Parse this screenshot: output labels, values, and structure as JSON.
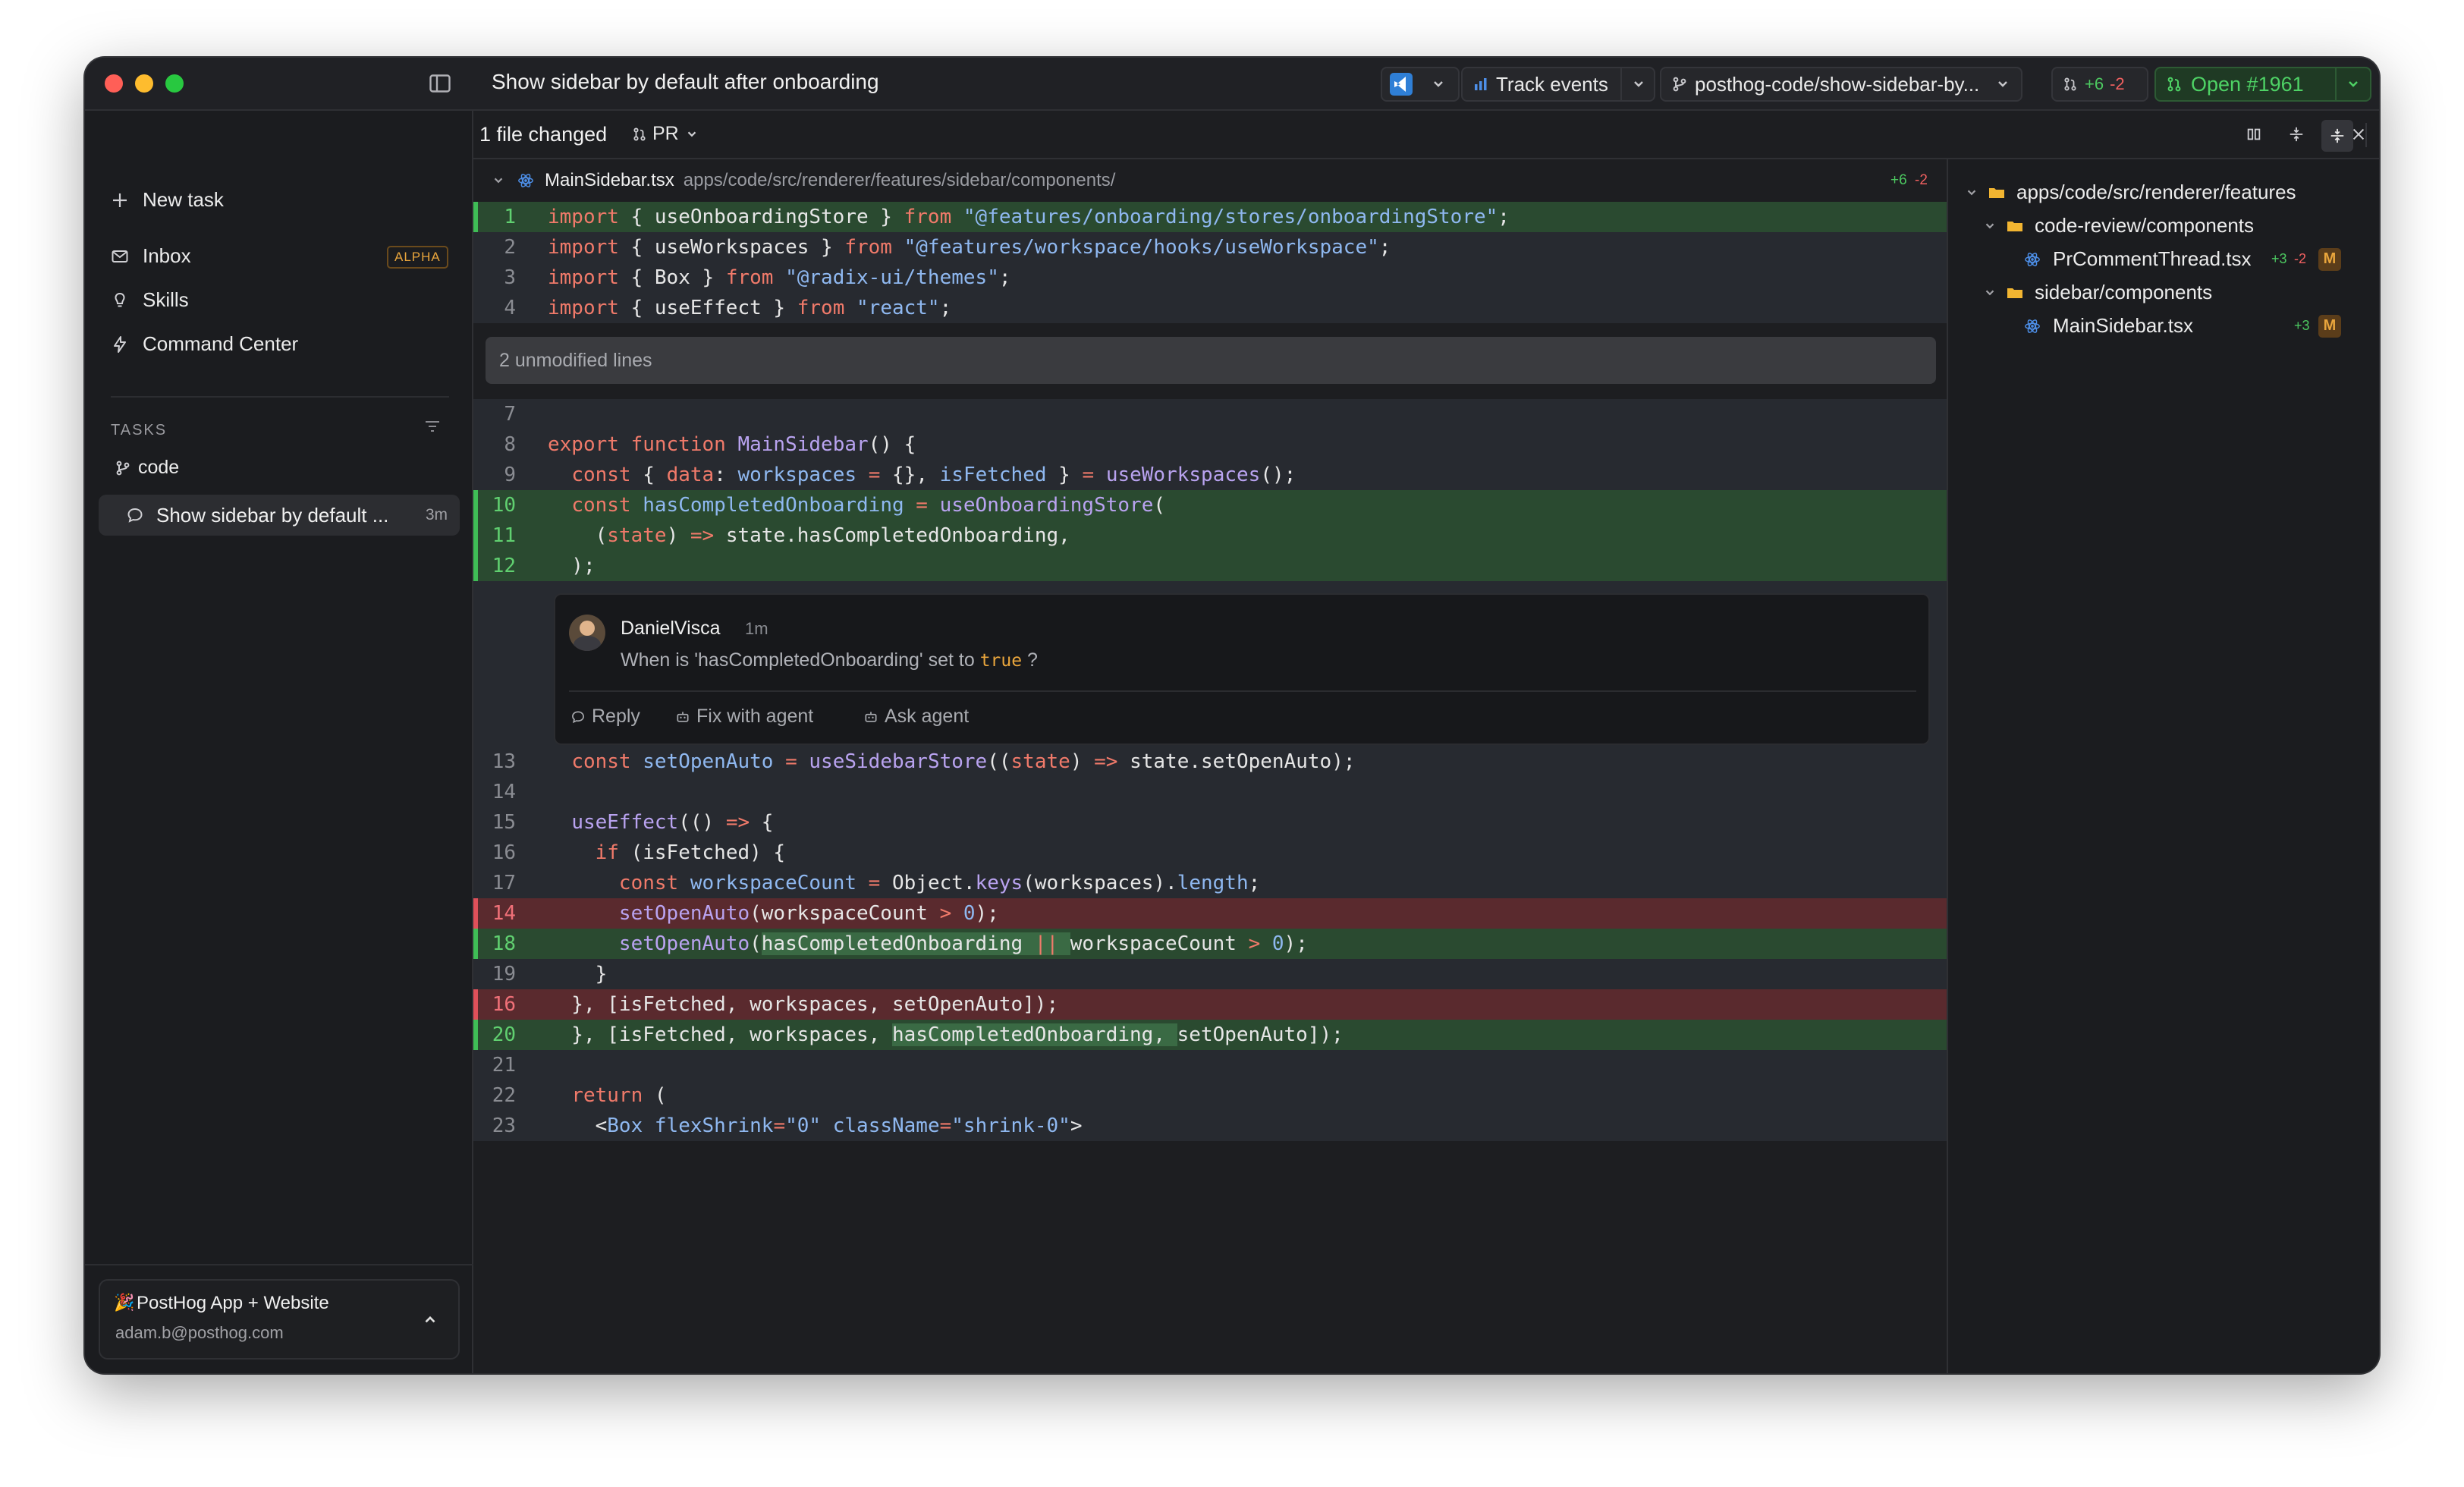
{
  "window": {
    "title": "Show sidebar by default after onboarding"
  },
  "toolbar": {
    "track_events": "Track events",
    "branch": "posthog-code/show-sidebar-by...",
    "diff_add": "+6",
    "diff_del": "-2",
    "pr_status": "Open #1961"
  },
  "sidebar": {
    "new_task": "New task",
    "inbox": "Inbox",
    "inbox_badge": "ALPHA",
    "skills": "Skills",
    "command_center": "Command Center",
    "tasks_header": "TASKS",
    "repo": "code",
    "active_task": "Show sidebar by default ...",
    "active_task_age": "3m",
    "org_name": "PostHog App + Website",
    "org_emoji": "🎉",
    "email": "adam.b@posthog.com"
  },
  "subheader": {
    "files_changed": "1 file changed",
    "pr_label": "PR"
  },
  "file": {
    "name": "MainSidebar.tsx",
    "path": "apps/code/src/renderer/features/sidebar/components/",
    "add": "+6",
    "del": "-2"
  },
  "unmodified": "2 unmodified lines",
  "comment": {
    "author": "DanielVisca",
    "time": "1m",
    "text_before": "When is 'hasCompletedOnboarding' set to ",
    "text_code": "true",
    "text_after": " ?",
    "reply": "Reply",
    "fix": "Fix with agent",
    "ask": "Ask agent"
  },
  "lines": {
    "l1": {
      "n": "1"
    },
    "l2": {
      "n": "2"
    },
    "l3": {
      "n": "3"
    },
    "l4": {
      "n": "4"
    },
    "l7": {
      "n": "7"
    },
    "l8": {
      "n": "8"
    },
    "l9": {
      "n": "9"
    },
    "l10": {
      "n": "10"
    },
    "l11": {
      "n": "11"
    },
    "l12": {
      "n": "12"
    },
    "l13": {
      "n": "13"
    },
    "l14": {
      "n": "14"
    },
    "l15": {
      "n": "15"
    },
    "l16": {
      "n": "16"
    },
    "l17": {
      "n": "17"
    },
    "d14": {
      "n": "14"
    },
    "l18": {
      "n": "18"
    },
    "l19": {
      "n": "19"
    },
    "d16": {
      "n": "16"
    },
    "l20": {
      "n": "20"
    },
    "l21": {
      "n": "21"
    },
    "l22": {
      "n": "22"
    },
    "l23": {
      "n": "23"
    }
  },
  "tree": {
    "root": "apps/code/src/renderer/features",
    "folder1": "code-review/components",
    "file1": "PrCommentThread.tsx",
    "file1_add": "+3",
    "file1_del": "-2",
    "file1_status": "M",
    "folder2": "sidebar/components",
    "file2": "MainSidebar.tsx",
    "file2_add": "+3",
    "file2_status": "M"
  },
  "colors": {
    "add_bg": "#2a4a30",
    "del_bg": "#5a2a2e",
    "accent_green": "#3fbd56",
    "accent_red": "#e0505a",
    "badge_orange": "#e9a53c"
  }
}
